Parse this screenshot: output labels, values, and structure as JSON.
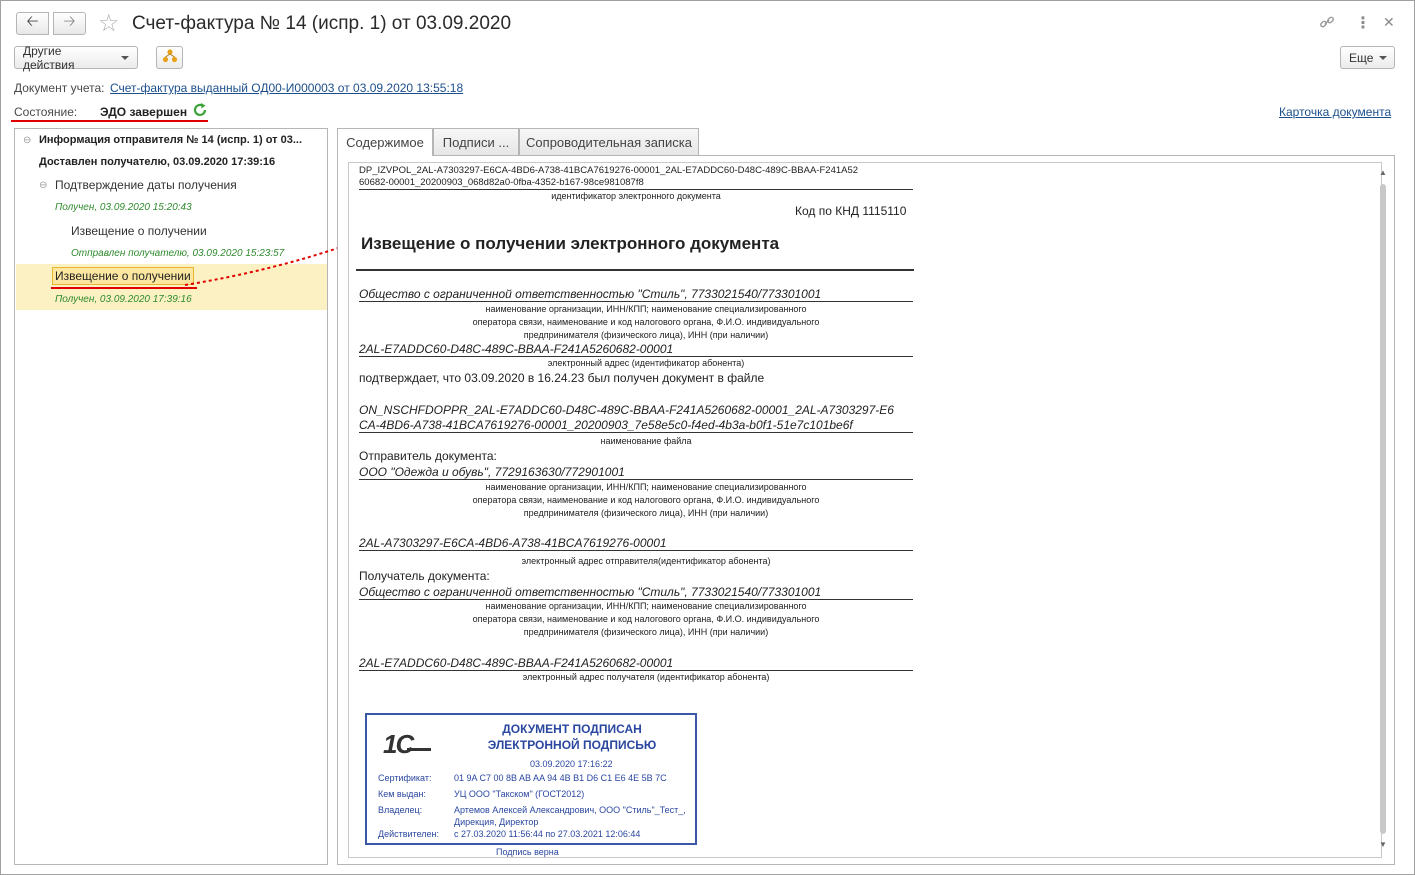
{
  "window": {
    "title": "Счет-фактура № 14 (испр. 1) от 03.09.2020"
  },
  "toolbar": {
    "other_actions": "Другие действия",
    "more": "Еще"
  },
  "doc_account": {
    "label": "Документ учета:",
    "link": "Счет-фактура выданный ОД00-И000003 от 03.09.2020 13:55:18"
  },
  "state": {
    "label": "Состояние:",
    "value": "ЭДО завершен"
  },
  "card_link": "Карточка документа",
  "tree": {
    "root_title": "Информация отправителя № 14 (испр. 1) от 03...",
    "root_status": "Доставлен получателю, 03.09.2020 17:39:16",
    "node1_title": "Подтверждение даты получения",
    "node1_status": "Получен, 03.09.2020 15:20:43",
    "node1_child_title": "Извещение о получении",
    "node1_child_status": "Отправлен получателю, 03.09.2020 15:23:57",
    "selected_title": "Извещение о получении",
    "selected_status": "Получен, 03.09.2020 17:39:16"
  },
  "tabs": [
    "Содержимое",
    "Подписи ...",
    "Сопроводительная записка"
  ],
  "document": {
    "file_id_line1": "DP_IZVPOL_2AL-A7303297-E6CA-4BD6-A738-41BCA7619276-00001_2AL-E7ADDC60-D48C-489C-BBAA-F241A52",
    "file_id_line2": "60682-00001_20200903_068d82a0-0fba-4352-b167-98ce981087f8",
    "file_id_caption": "идентификатор электронного документа",
    "knd": "Код по КНД 1115110",
    "heading": "Извещение о получении электронного документа",
    "org1": "Общество с ограниченной ответственностью \"Стиль\", 7733021540/773301001",
    "org_caption_1": "наименование организации, ИНН/КПП; наименование специализированного",
    "org_caption_2": "оператора связи, наименование и код налогового органа, Ф.И.О. индивидуального",
    "org_caption_3": "предпринимателя (физического лица), ИНН (при наличии)",
    "addr1": "2AL-E7ADDC60-D48C-489C-BBAA-F241A5260682-00001",
    "addr1_caption": "электронный адрес (идентификатор абонента)",
    "confirm_text": "подтверждает, что 03.09.2020 в 16.24.23 был получен документ в файле",
    "filename_line1": "ON_NSCHFDOPPR_2AL-E7ADDC60-D48C-489C-BBAA-F241A5260682-00001_2AL-A7303297-E6",
    "filename_line2": "CA-4BD6-A738-41BCA7619276-00001_20200903_7e58e5c0-f4ed-4b3a-b0f1-51e7c101be6f",
    "filename_caption": "наименование файла",
    "sender_label": "Отправитель документа:",
    "sender_org": "ООО \"Одежда и обувь\", 7729163630/772901001",
    "sender_caption_1": "наименование организации, ИНН/КПП; наименование специализированного",
    "sender_caption_2": "оператора связи, наименование и код налогового органа, Ф.И.О. индивидуального",
    "sender_caption_3": "предпринимателя (физического лица), ИНН (при наличии)",
    "sender_addr": "2AL-A7303297-E6CA-4BD6-A738-41BCA7619276-00001",
    "sender_addr_caption": "электронный адрес отправителя(идентификатор абонента)",
    "receiver_label": "Получатель документа:",
    "receiver_org": "Общество с ограниченной ответственностью \"Стиль\", 7733021540/773301001",
    "receiver_caption_1": "наименование организации, ИНН/КПП; наименование специализированного",
    "receiver_caption_2": "оператора связи, наименование и код налогового органа, Ф.И.О. индивидуального",
    "receiver_caption_3": "предпринимателя (физического лица), ИНН (при наличии)",
    "receiver_addr": "2AL-E7ADDC60-D48C-489C-BBAA-F241A5260682-00001",
    "receiver_addr_caption": "электронный адрес получателя (идентификатор абонента)"
  },
  "stamp": {
    "logo": "1С",
    "title": "ДОКУМЕНТ ПОДПИСАН ЭЛЕКТРОННОЙ ПОДПИСЬЮ",
    "date": "03.09.2020 17:16:22",
    "cert_label": "Сертификат:",
    "cert_value": "01 9A C7 00 8B AB AA 94 4B B1 D6 C1 E6 4E 5B 7C",
    "issuer_label": "Кем выдан:",
    "issuer_value": "УЦ ООО \"Такском\" (ГОСТ2012)",
    "owner_label": "Владелец:",
    "owner_value_1": "Артемов Алексей Александрович, ООО \"Стиль\"_Тест_,",
    "owner_value_2": "Дирекция, Директор",
    "valid_label": "Действителен:",
    "valid_value": "с 27.03.2020 11:56:44 по 27.03.2021 12:06:44",
    "verdict": "Подпись верна"
  },
  "colors": {
    "link": "#1c4f8c",
    "ok_green": "#2e8b2e",
    "selection": "#fbf1c2",
    "stamp_blue": "#3a57a8",
    "annotation_red": "#e00000"
  },
  "icons": [
    "arrow-left-icon",
    "arrow-right-icon",
    "star-icon",
    "link-icon",
    "more-vert-icon",
    "close-icon",
    "structure-icon",
    "refresh-icon"
  ]
}
